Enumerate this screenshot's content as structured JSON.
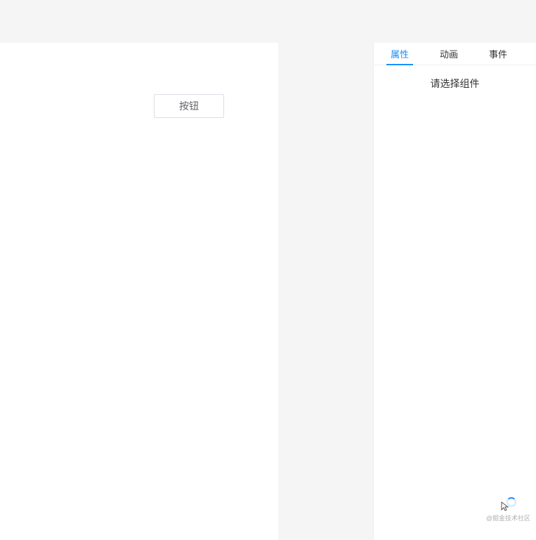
{
  "canvas": {
    "button_label": "按钮"
  },
  "panel": {
    "tabs": [
      {
        "label": "属性",
        "active": true
      },
      {
        "label": "动画",
        "active": false
      },
      {
        "label": "事件",
        "active": false
      }
    ],
    "placeholder": "请选择组件"
  },
  "watermark": {
    "text": "@掘金技术社区"
  }
}
